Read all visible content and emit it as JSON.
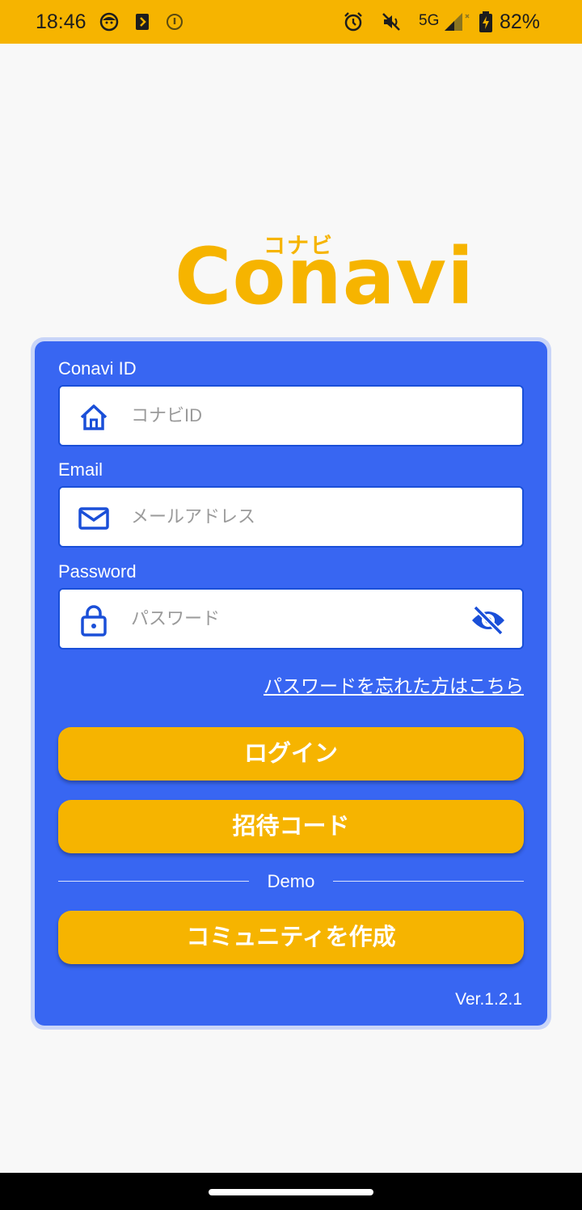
{
  "status_bar": {
    "time": "18:46",
    "network": "5G",
    "battery": "82%",
    "icons": [
      "face-icon",
      "notification-icon",
      "info-icon",
      "alarm-icon",
      "mute-icon",
      "signal-icon",
      "battery-charging-icon"
    ]
  },
  "logo": {
    "kana": "コナビ",
    "text": "Conavi",
    "color": "#f6b400"
  },
  "form": {
    "conavi_id": {
      "label": "Conavi ID",
      "placeholder": "コナビID",
      "value": ""
    },
    "email": {
      "label": "Email",
      "placeholder": "メールアドレス",
      "value": ""
    },
    "password": {
      "label": "Password",
      "placeholder": "パスワード",
      "value": ""
    },
    "forgot_password": "パスワードを忘れた方はこちら"
  },
  "buttons": {
    "login": "ログイン",
    "invite_code": "招待コード",
    "create_community": "コミュニティを作成"
  },
  "divider_label": "Demo",
  "version": "Ver.1.2.1",
  "colors": {
    "accent": "#f6b400",
    "card": "#3866f2",
    "icon": "#1a4fd8"
  }
}
